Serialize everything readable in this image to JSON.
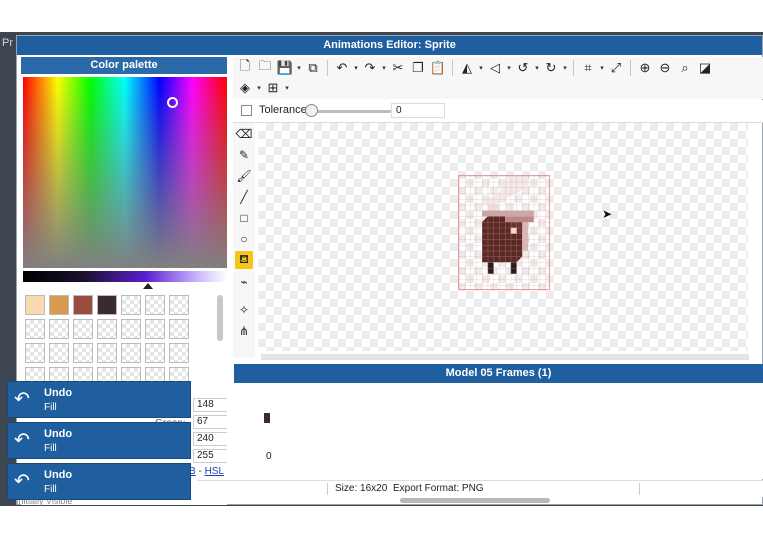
{
  "background_window": {
    "title_fragment": "Pr",
    "bottom_label": "Initially Visible"
  },
  "editor": {
    "title": "Animations Editor: Sprite"
  },
  "palette": {
    "header": "Color palette",
    "swatches": [
      "#f9d9b0",
      "#d99a50",
      "#9a4c40",
      "#3b2a30"
    ],
    "rgb_values": [
      "148",
      "67",
      "240",
      "255"
    ],
    "green_label": "Green:",
    "b_label": "B",
    "dash": " - ",
    "hsl_label": "HSL"
  },
  "toolbar": {
    "row1": [
      "new-file-icon",
      "open-folder-icon",
      "save-icon",
      "save-as-icon",
      "undo-icon",
      "redo-icon",
      "cut-icon",
      "copy-icon",
      "paste-icon",
      "flip-horizontal-icon",
      "flip-vertical-icon",
      "rotate-left-icon",
      "rotate-right-icon",
      "crop-icon",
      "resize-icon",
      "zoom-in-icon",
      "zoom-out-icon",
      "zoom-fit-icon",
      "toggle-icon"
    ],
    "row2": [
      "layers-icon",
      "grid-icon"
    ]
  },
  "options": {
    "tolerance_label": "Tolerance",
    "tolerance_value": "0",
    "tolerance_level": 0
  },
  "tools": [
    "eraser-icon",
    "pencil-icon",
    "brush-icon",
    "line-icon",
    "rectangle-icon",
    "ellipse-icon",
    "fill-bucket-icon",
    "eyedropper-icon",
    "move-point-icon",
    "nodes-icon"
  ],
  "active_tool": "fill-bucket-icon",
  "sprite": {
    "width": 16,
    "height": 20
  },
  "frames": {
    "header": "Model 05 Frames (1)",
    "frame_number": "0"
  },
  "status": {
    "size": "Size: 16x20",
    "format": "Export Format: PNG"
  },
  "toasts": [
    {
      "title": "Undo",
      "subtitle": "Fill"
    },
    {
      "title": "Undo",
      "subtitle": "Fill"
    },
    {
      "title": "Undo",
      "subtitle": "Fill"
    }
  ]
}
